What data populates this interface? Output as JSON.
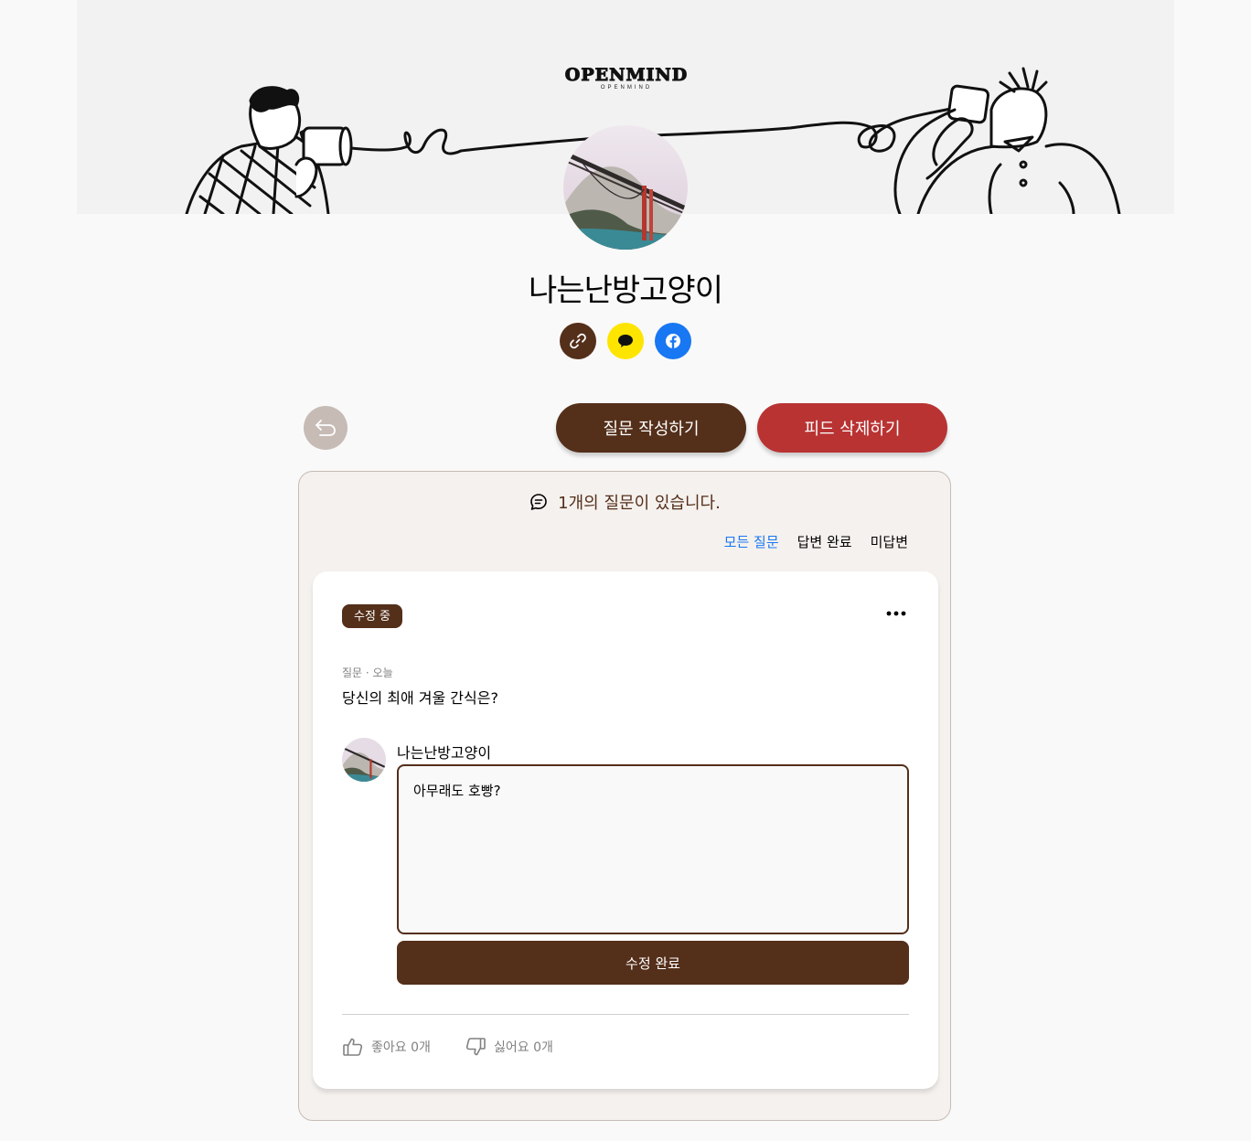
{
  "brand": {
    "logo_main": "OPENMIND",
    "logo_sub": "OPENMIND"
  },
  "profile": {
    "name": "나는난방고양이",
    "avatar_icon": "bridge-photo"
  },
  "share": {
    "link_icon": "link-icon",
    "kakao_icon": "kakao-icon",
    "facebook_icon": "facebook-icon",
    "link_color": "#542f1a",
    "kakao_color": "#fee500",
    "facebook_color": "#1877f2"
  },
  "actions": {
    "back_icon": "back-arrow-icon",
    "ask_label": "질문 작성하기",
    "delete_label": "피드 삭제하기",
    "ask_color": "#542f1a",
    "delete_color": "#b93333"
  },
  "feed": {
    "count_text": "1개의 질문이 있습니다.",
    "filters": [
      {
        "label": "모든 질문",
        "active": true
      },
      {
        "label": "답변 완료",
        "active": false
      },
      {
        "label": "미답변",
        "active": false
      }
    ],
    "card": {
      "badge": "수정 중",
      "meta": "질문 · 오늘",
      "question": "당신의 최애 겨울 간식은?",
      "answerer": "나는난방고양이",
      "answer_value": "아무래도 호빵?",
      "submit_label": "수정 완료",
      "like_label": "좋아요 0개",
      "dislike_label": "싫어요 0개"
    }
  }
}
